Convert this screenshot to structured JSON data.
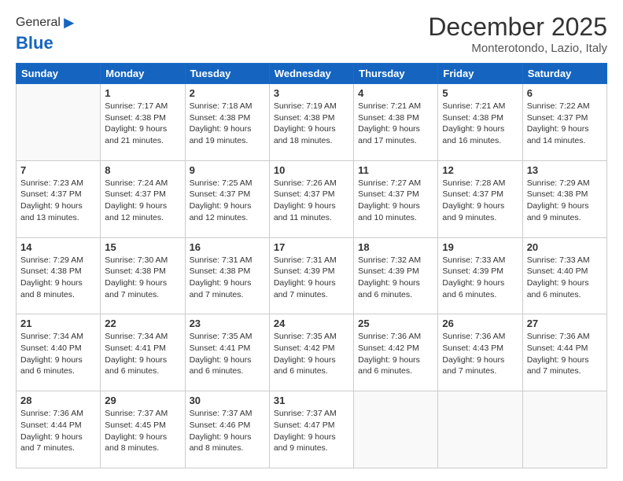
{
  "header": {
    "logo_general": "General",
    "logo_blue": "Blue",
    "title": "December 2025",
    "subtitle": "Monterotondo, Lazio, Italy"
  },
  "weekdays": [
    "Sunday",
    "Monday",
    "Tuesday",
    "Wednesday",
    "Thursday",
    "Friday",
    "Saturday"
  ],
  "weeks": [
    [
      {
        "day": "",
        "sunrise": "",
        "sunset": "",
        "daylight": ""
      },
      {
        "day": "1",
        "sunrise": "Sunrise: 7:17 AM",
        "sunset": "Sunset: 4:38 PM",
        "daylight": "Daylight: 9 hours and 21 minutes."
      },
      {
        "day": "2",
        "sunrise": "Sunrise: 7:18 AM",
        "sunset": "Sunset: 4:38 PM",
        "daylight": "Daylight: 9 hours and 19 minutes."
      },
      {
        "day": "3",
        "sunrise": "Sunrise: 7:19 AM",
        "sunset": "Sunset: 4:38 PM",
        "daylight": "Daylight: 9 hours and 18 minutes."
      },
      {
        "day": "4",
        "sunrise": "Sunrise: 7:21 AM",
        "sunset": "Sunset: 4:38 PM",
        "daylight": "Daylight: 9 hours and 17 minutes."
      },
      {
        "day": "5",
        "sunrise": "Sunrise: 7:21 AM",
        "sunset": "Sunset: 4:38 PM",
        "daylight": "Daylight: 9 hours and 16 minutes."
      },
      {
        "day": "6",
        "sunrise": "Sunrise: 7:22 AM",
        "sunset": "Sunset: 4:37 PM",
        "daylight": "Daylight: 9 hours and 14 minutes."
      }
    ],
    [
      {
        "day": "7",
        "sunrise": "Sunrise: 7:23 AM",
        "sunset": "Sunset: 4:37 PM",
        "daylight": "Daylight: 9 hours and 13 minutes."
      },
      {
        "day": "8",
        "sunrise": "Sunrise: 7:24 AM",
        "sunset": "Sunset: 4:37 PM",
        "daylight": "Daylight: 9 hours and 12 minutes."
      },
      {
        "day": "9",
        "sunrise": "Sunrise: 7:25 AM",
        "sunset": "Sunset: 4:37 PM",
        "daylight": "Daylight: 9 hours and 12 minutes."
      },
      {
        "day": "10",
        "sunrise": "Sunrise: 7:26 AM",
        "sunset": "Sunset: 4:37 PM",
        "daylight": "Daylight: 9 hours and 11 minutes."
      },
      {
        "day": "11",
        "sunrise": "Sunrise: 7:27 AM",
        "sunset": "Sunset: 4:37 PM",
        "daylight": "Daylight: 9 hours and 10 minutes."
      },
      {
        "day": "12",
        "sunrise": "Sunrise: 7:28 AM",
        "sunset": "Sunset: 4:37 PM",
        "daylight": "Daylight: 9 hours and 9 minutes."
      },
      {
        "day": "13",
        "sunrise": "Sunrise: 7:29 AM",
        "sunset": "Sunset: 4:38 PM",
        "daylight": "Daylight: 9 hours and 9 minutes."
      }
    ],
    [
      {
        "day": "14",
        "sunrise": "Sunrise: 7:29 AM",
        "sunset": "Sunset: 4:38 PM",
        "daylight": "Daylight: 9 hours and 8 minutes."
      },
      {
        "day": "15",
        "sunrise": "Sunrise: 7:30 AM",
        "sunset": "Sunset: 4:38 PM",
        "daylight": "Daylight: 9 hours and 7 minutes."
      },
      {
        "day": "16",
        "sunrise": "Sunrise: 7:31 AM",
        "sunset": "Sunset: 4:38 PM",
        "daylight": "Daylight: 9 hours and 7 minutes."
      },
      {
        "day": "17",
        "sunrise": "Sunrise: 7:31 AM",
        "sunset": "Sunset: 4:39 PM",
        "daylight": "Daylight: 9 hours and 7 minutes."
      },
      {
        "day": "18",
        "sunrise": "Sunrise: 7:32 AM",
        "sunset": "Sunset: 4:39 PM",
        "daylight": "Daylight: 9 hours and 6 minutes."
      },
      {
        "day": "19",
        "sunrise": "Sunrise: 7:33 AM",
        "sunset": "Sunset: 4:39 PM",
        "daylight": "Daylight: 9 hours and 6 minutes."
      },
      {
        "day": "20",
        "sunrise": "Sunrise: 7:33 AM",
        "sunset": "Sunset: 4:40 PM",
        "daylight": "Daylight: 9 hours and 6 minutes."
      }
    ],
    [
      {
        "day": "21",
        "sunrise": "Sunrise: 7:34 AM",
        "sunset": "Sunset: 4:40 PM",
        "daylight": "Daylight: 9 hours and 6 minutes."
      },
      {
        "day": "22",
        "sunrise": "Sunrise: 7:34 AM",
        "sunset": "Sunset: 4:41 PM",
        "daylight": "Daylight: 9 hours and 6 minutes."
      },
      {
        "day": "23",
        "sunrise": "Sunrise: 7:35 AM",
        "sunset": "Sunset: 4:41 PM",
        "daylight": "Daylight: 9 hours and 6 minutes."
      },
      {
        "day": "24",
        "sunrise": "Sunrise: 7:35 AM",
        "sunset": "Sunset: 4:42 PM",
        "daylight": "Daylight: 9 hours and 6 minutes."
      },
      {
        "day": "25",
        "sunrise": "Sunrise: 7:36 AM",
        "sunset": "Sunset: 4:42 PM",
        "daylight": "Daylight: 9 hours and 6 minutes."
      },
      {
        "day": "26",
        "sunrise": "Sunrise: 7:36 AM",
        "sunset": "Sunset: 4:43 PM",
        "daylight": "Daylight: 9 hours and 7 minutes."
      },
      {
        "day": "27",
        "sunrise": "Sunrise: 7:36 AM",
        "sunset": "Sunset: 4:44 PM",
        "daylight": "Daylight: 9 hours and 7 minutes."
      }
    ],
    [
      {
        "day": "28",
        "sunrise": "Sunrise: 7:36 AM",
        "sunset": "Sunset: 4:44 PM",
        "daylight": "Daylight: 9 hours and 7 minutes."
      },
      {
        "day": "29",
        "sunrise": "Sunrise: 7:37 AM",
        "sunset": "Sunset: 4:45 PM",
        "daylight": "Daylight: 9 hours and 8 minutes."
      },
      {
        "day": "30",
        "sunrise": "Sunrise: 7:37 AM",
        "sunset": "Sunset: 4:46 PM",
        "daylight": "Daylight: 9 hours and 8 minutes."
      },
      {
        "day": "31",
        "sunrise": "Sunrise: 7:37 AM",
        "sunset": "Sunset: 4:47 PM",
        "daylight": "Daylight: 9 hours and 9 minutes."
      },
      {
        "day": "",
        "sunrise": "",
        "sunset": "",
        "daylight": ""
      },
      {
        "day": "",
        "sunrise": "",
        "sunset": "",
        "daylight": ""
      },
      {
        "day": "",
        "sunrise": "",
        "sunset": "",
        "daylight": ""
      }
    ]
  ]
}
